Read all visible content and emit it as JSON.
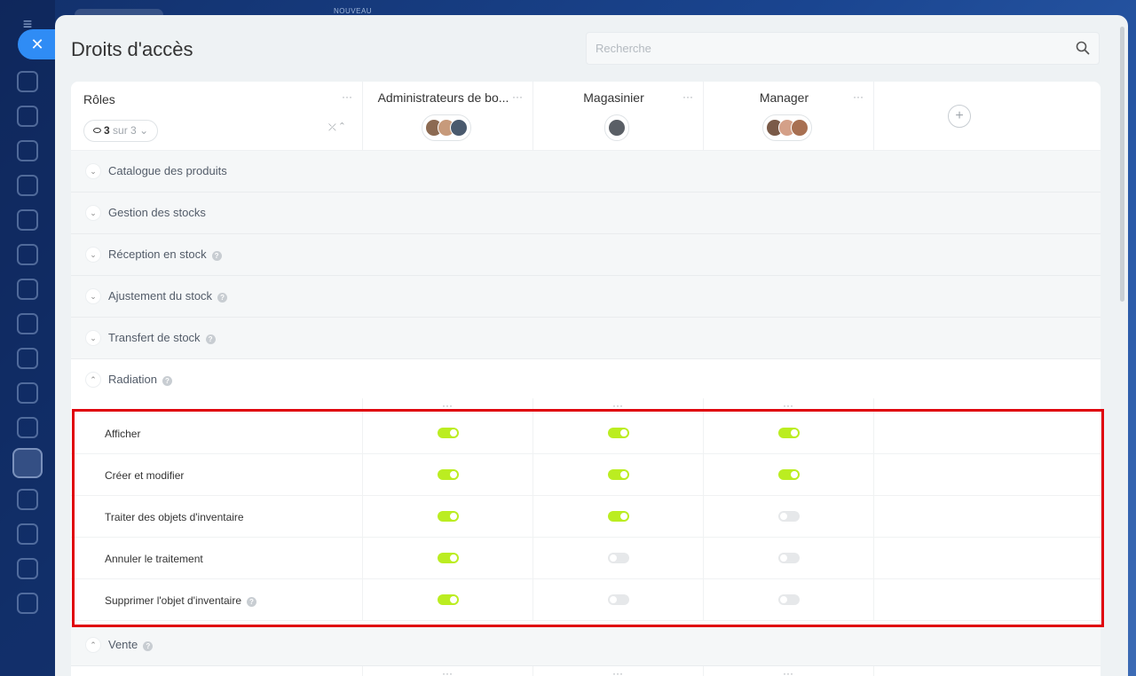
{
  "background": {
    "label": "NOUVEAU"
  },
  "page": {
    "title": "Droits d'accès"
  },
  "search": {
    "placeholder": "Recherche"
  },
  "roles_header": {
    "title": "Rôles",
    "filter_count": "3",
    "filter_suffix": "sur 3"
  },
  "roles": [
    {
      "name": "Administrateurs de bo...",
      "avatar_colors": [
        "#8c6a52",
        "#c79a7b",
        "#4a5a6e"
      ]
    },
    {
      "name": "Magasinier",
      "avatar_colors": [
        "#5a5f66"
      ]
    },
    {
      "name": "Manager",
      "avatar_colors": [
        "#7a5a48",
        "#d4a088",
        "#a87052"
      ]
    }
  ],
  "sections": [
    {
      "label": "Catalogue des produits",
      "help": false,
      "expanded": false
    },
    {
      "label": "Gestion des stocks",
      "help": false,
      "expanded": false
    },
    {
      "label": "Réception en stock",
      "help": true,
      "expanded": false
    },
    {
      "label": "Ajustement du stock",
      "help": true,
      "expanded": false
    },
    {
      "label": "Transfert de stock",
      "help": true,
      "expanded": false
    },
    {
      "label": "Radiation",
      "help": true,
      "expanded": true
    }
  ],
  "radiation_permissions": [
    {
      "label": "Afficher",
      "help": false,
      "values": [
        true,
        true,
        true
      ]
    },
    {
      "label": "Créer et modifier",
      "help": false,
      "values": [
        true,
        true,
        true
      ]
    },
    {
      "label": "Traiter des objets d'inventaire",
      "help": false,
      "values": [
        true,
        true,
        false
      ]
    },
    {
      "label": "Annuler le traitement",
      "help": false,
      "values": [
        true,
        false,
        false
      ]
    },
    {
      "label": "Supprimer l'objet d'inventaire",
      "help": true,
      "values": [
        true,
        false,
        false
      ]
    }
  ],
  "next_section": {
    "label": "Vente",
    "help": true,
    "expanded": true
  },
  "colors": {
    "toggle_on": "#bbed21",
    "toggle_off": "#e6e8ea",
    "highlight": "#e0040d",
    "accent": "#2f8cf5"
  }
}
